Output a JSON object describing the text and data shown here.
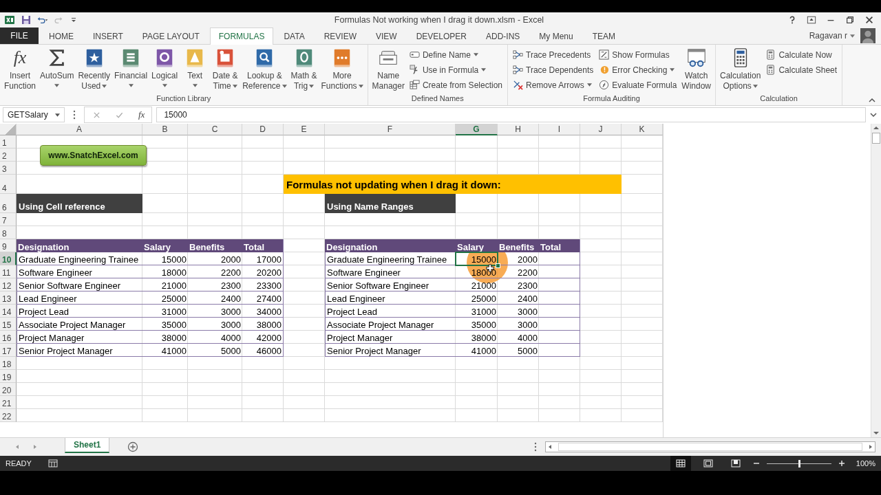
{
  "window": {
    "title": "Formulas Not working when I drag it down.xlsm - Excel",
    "user": "Ragavan r"
  },
  "ribbon_tabs": [
    {
      "label": "FILE",
      "kind": "file",
      "selected": false
    },
    {
      "label": "HOME",
      "kind": "tab",
      "selected": false
    },
    {
      "label": "INSERT",
      "kind": "tab",
      "selected": false
    },
    {
      "label": "PAGE LAYOUT",
      "kind": "tab",
      "selected": false
    },
    {
      "label": "FORMULAS",
      "kind": "tab",
      "selected": true
    },
    {
      "label": "DATA",
      "kind": "tab",
      "selected": false
    },
    {
      "label": "REVIEW",
      "kind": "tab",
      "selected": false
    },
    {
      "label": "VIEW",
      "kind": "tab",
      "selected": false
    },
    {
      "label": "DEVELOPER",
      "kind": "tab",
      "selected": false
    },
    {
      "label": "ADD-INS",
      "kind": "tab",
      "selected": false
    },
    {
      "label": "My Menu",
      "kind": "tab",
      "selected": false
    },
    {
      "label": "TEAM",
      "kind": "tab",
      "selected": false
    }
  ],
  "ribbon": {
    "groups": [
      {
        "label": "Function Library",
        "items": [
          {
            "kind": "large",
            "glyph": "fx",
            "lines": [
              "Insert",
              "Function"
            ],
            "caret": false
          },
          {
            "kind": "large",
            "lines": [
              "AutoSum"
            ],
            "caret": true
          },
          {
            "kind": "large",
            "lines": [
              "Recently",
              "Used"
            ],
            "caret": true
          },
          {
            "kind": "large",
            "lines": [
              "Financial"
            ],
            "caret": true
          },
          {
            "kind": "large",
            "lines": [
              "Logical"
            ],
            "caret": true
          },
          {
            "kind": "large",
            "lines": [
              "Text"
            ],
            "caret": true
          },
          {
            "kind": "large",
            "lines": [
              "Date &",
              "Time"
            ],
            "caret": true
          },
          {
            "kind": "large",
            "lines": [
              "Lookup &",
              "Reference"
            ],
            "caret": true
          },
          {
            "kind": "large",
            "lines": [
              "Math &",
              "Trig"
            ],
            "caret": true
          },
          {
            "kind": "large",
            "lines": [
              "More",
              "Functions"
            ],
            "caret": true
          }
        ]
      },
      {
        "label": "Defined Names",
        "items": [
          {
            "kind": "large",
            "lines": [
              "Name",
              "Manager"
            ],
            "caret": false
          },
          {
            "kind": "stack",
            "buttons": [
              {
                "label": "Define Name",
                "caret": true
              },
              {
                "label": "Use in Formula",
                "caret": true
              },
              {
                "label": "Create from Selection",
                "caret": false
              }
            ]
          }
        ]
      },
      {
        "label": "Formula Auditing",
        "items": [
          {
            "kind": "stack",
            "buttons": [
              {
                "label": "Trace Precedents",
                "caret": false
              },
              {
                "label": "Trace Dependents",
                "caret": false
              },
              {
                "label": "Remove Arrows",
                "caret": true
              }
            ]
          },
          {
            "kind": "stack",
            "buttons": [
              {
                "label": "Show Formulas",
                "caret": false
              },
              {
                "label": "Error Checking",
                "caret": true
              },
              {
                "label": "Evaluate Formula",
                "caret": false
              }
            ]
          },
          {
            "kind": "large",
            "lines": [
              "Watch",
              "Window"
            ],
            "caret": false
          }
        ]
      },
      {
        "label": "Calculation",
        "items": [
          {
            "kind": "large",
            "lines": [
              "Calculation",
              "Options"
            ],
            "caret": true
          },
          {
            "kind": "stack",
            "buttons": [
              {
                "label": "Calculate Now",
                "caret": false
              },
              {
                "label": "Calculate Sheet",
                "caret": false
              }
            ]
          }
        ]
      }
    ]
  },
  "formula_bar": {
    "name_box": "GETSalary",
    "fx": "fx",
    "value": "15000"
  },
  "sheet": {
    "columns": [
      {
        "letter": "A",
        "selected": false
      },
      {
        "letter": "B",
        "selected": false
      },
      {
        "letter": "C",
        "selected": false
      },
      {
        "letter": "D",
        "selected": false
      },
      {
        "letter": "E",
        "selected": false
      },
      {
        "letter": "F",
        "selected": false
      },
      {
        "letter": "G",
        "selected": true
      },
      {
        "letter": "H",
        "selected": false
      },
      {
        "letter": "I",
        "selected": false
      },
      {
        "letter": "J",
        "selected": false
      },
      {
        "letter": "K",
        "selected": false
      }
    ],
    "rows": [
      {
        "number": "1",
        "selected": false
      },
      {
        "number": "2",
        "selected": false
      },
      {
        "number": "3",
        "selected": false
      },
      {
        "number": "4",
        "selected": false
      },
      {
        "number": "6",
        "selected": false
      },
      {
        "number": "7",
        "selected": false
      },
      {
        "number": "8",
        "selected": false
      },
      {
        "number": "9",
        "selected": false
      },
      {
        "number": "10",
        "selected": true
      },
      {
        "number": "11",
        "selected": false
      },
      {
        "number": "12",
        "selected": false
      },
      {
        "number": "13",
        "selected": false
      },
      {
        "number": "14",
        "selected": false
      },
      {
        "number": "15",
        "selected": false
      },
      {
        "number": "16",
        "selected": false
      },
      {
        "number": "17",
        "selected": false
      },
      {
        "number": "18",
        "selected": false
      },
      {
        "number": "19",
        "selected": false
      },
      {
        "number": "20",
        "selected": false
      },
      {
        "number": "21",
        "selected": false
      },
      {
        "number": "22",
        "selected": false
      }
    ],
    "link_button": "www.SnatchExcel.com",
    "banner": "Formulas not updating when I drag it down:",
    "tables": [
      {
        "heading": "Using Cell reference",
        "columns": [
          "Designation",
          "Salary",
          "Benefits",
          "Total"
        ],
        "rows": [
          [
            "Graduate Engineering Trainee",
            "15000",
            "2000",
            "17000"
          ],
          [
            "Software Engineer",
            "18000",
            "2200",
            "20200"
          ],
          [
            "Senior Software Engineer",
            "21000",
            "2300",
            "23300"
          ],
          [
            "Lead Engineer",
            "25000",
            "2400",
            "27400"
          ],
          [
            "Project Lead",
            "31000",
            "3000",
            "34000"
          ],
          [
            "Associate Project Manager",
            "35000",
            "3000",
            "38000"
          ],
          [
            "Project Manager",
            "38000",
            "4000",
            "42000"
          ],
          [
            "Senior Project Manager",
            "41000",
            "5000",
            "46000"
          ]
        ]
      },
      {
        "heading": "Using Name Ranges",
        "columns": [
          "Designation",
          "Salary",
          "Benefits",
          "Total"
        ],
        "rows": [
          [
            "Graduate Engineering Trainee",
            "15000",
            "2000"
          ],
          [
            "Software Engineer",
            "18000",
            "2200"
          ],
          [
            "Senior Software Engineer",
            "21000",
            "2300"
          ],
          [
            "Lead Engineer",
            "25000",
            "2400"
          ],
          [
            "Project Lead",
            "31000",
            "3000"
          ],
          [
            "Associate Project Manager",
            "35000",
            "3000"
          ],
          [
            "Project Manager",
            "38000",
            "4000"
          ],
          [
            "Senior Project Manager",
            "41000",
            "5000"
          ]
        ]
      }
    ]
  },
  "sheet_tabs": [
    {
      "label": "Sheet1",
      "selected": true
    }
  ],
  "status_bar": {
    "status": "READY",
    "views": [
      {
        "selected": true
      },
      {
        "selected": false
      },
      {
        "selected": false
      }
    ],
    "zoom_slider": {
      "level": 0.5
    },
    "zoom": "100%"
  }
}
